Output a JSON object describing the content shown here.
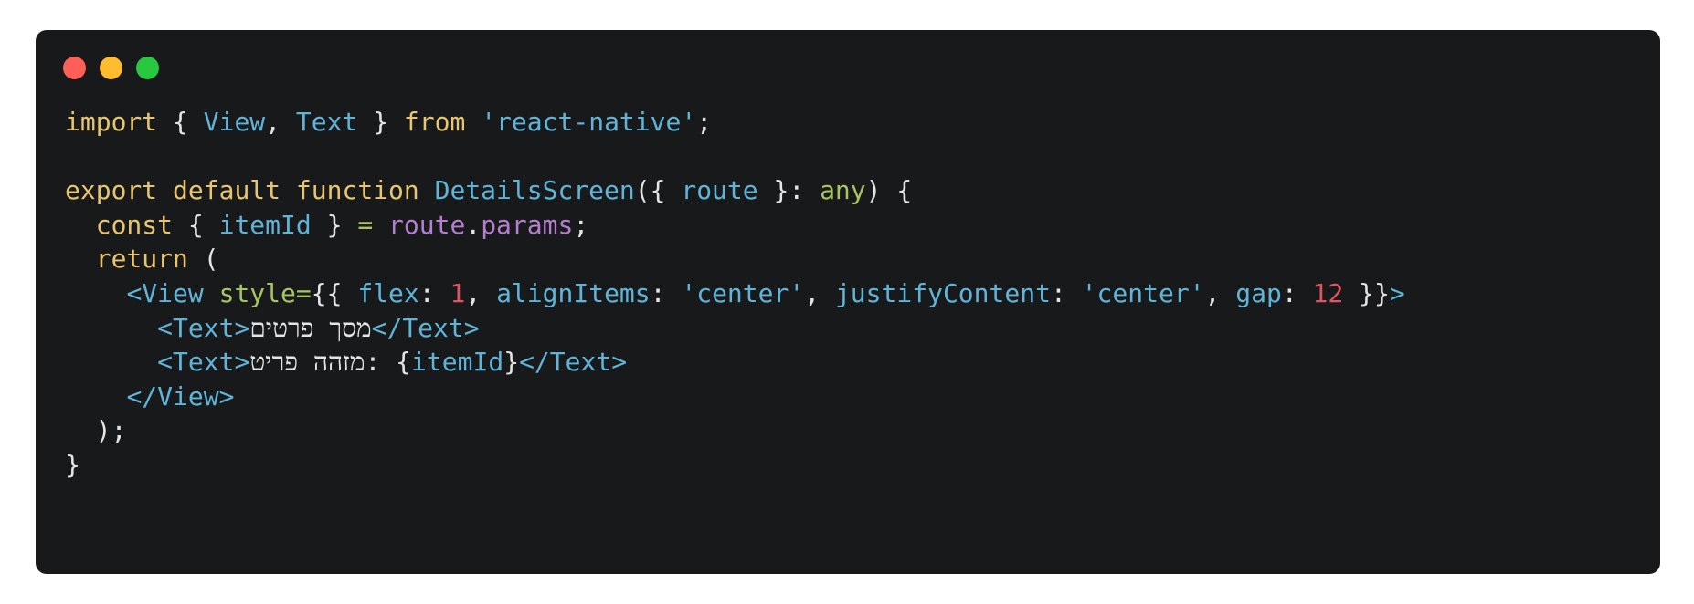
{
  "window": {
    "background": "#18191b",
    "controls": [
      {
        "name": "close",
        "color": "#ff5f57"
      },
      {
        "name": "minimize",
        "color": "#febc2e"
      },
      {
        "name": "zoom",
        "color": "#28c840"
      }
    ]
  },
  "colors": {
    "keyword": "#e8c66f",
    "identifier": "#5fb4d8",
    "string": "#5fb4d8",
    "plain": "#e4e4e4",
    "type": "#a8c55f",
    "property": "#b57fd0",
    "number": "#e05561",
    "operator": "#a8c55f"
  },
  "code": {
    "lines": [
      {
        "tokens": [
          {
            "t": "import",
            "c": "keyword"
          },
          {
            "t": " { ",
            "c": "plain"
          },
          {
            "t": "View",
            "c": "identifier"
          },
          {
            "t": ", ",
            "c": "plain"
          },
          {
            "t": "Text",
            "c": "identifier"
          },
          {
            "t": " } ",
            "c": "plain"
          },
          {
            "t": "from",
            "c": "keyword"
          },
          {
            "t": " ",
            "c": "plain"
          },
          {
            "t": "'react-native'",
            "c": "string"
          },
          {
            "t": ";",
            "c": "plain"
          }
        ]
      },
      {
        "tokens": []
      },
      {
        "tokens": [
          {
            "t": "export",
            "c": "keyword"
          },
          {
            "t": " ",
            "c": "plain"
          },
          {
            "t": "default",
            "c": "keyword"
          },
          {
            "t": " ",
            "c": "plain"
          },
          {
            "t": "function",
            "c": "keyword"
          },
          {
            "t": " ",
            "c": "plain"
          },
          {
            "t": "DetailsScreen",
            "c": "identifier"
          },
          {
            "t": "({ ",
            "c": "plain"
          },
          {
            "t": "route",
            "c": "identifier"
          },
          {
            "t": " }: ",
            "c": "plain"
          },
          {
            "t": "any",
            "c": "type"
          },
          {
            "t": ") {",
            "c": "plain"
          }
        ]
      },
      {
        "tokens": [
          {
            "t": "  ",
            "c": "plain"
          },
          {
            "t": "const",
            "c": "keyword"
          },
          {
            "t": " { ",
            "c": "plain"
          },
          {
            "t": "itemId",
            "c": "identifier"
          },
          {
            "t": " } ",
            "c": "plain"
          },
          {
            "t": "=",
            "c": "operator"
          },
          {
            "t": " ",
            "c": "plain"
          },
          {
            "t": "route",
            "c": "property"
          },
          {
            "t": ".",
            "c": "plain"
          },
          {
            "t": "params",
            "c": "property"
          },
          {
            "t": ";",
            "c": "plain"
          }
        ]
      },
      {
        "tokens": [
          {
            "t": "  ",
            "c": "plain"
          },
          {
            "t": "return",
            "c": "keyword"
          },
          {
            "t": " (",
            "c": "plain"
          }
        ]
      },
      {
        "tokens": [
          {
            "t": "    ",
            "c": "plain"
          },
          {
            "t": "<View",
            "c": "identifier"
          },
          {
            "t": " ",
            "c": "plain"
          },
          {
            "t": "style",
            "c": "type"
          },
          {
            "t": "=",
            "c": "operator"
          },
          {
            "t": "{{ ",
            "c": "plain"
          },
          {
            "t": "flex",
            "c": "identifier"
          },
          {
            "t": ": ",
            "c": "plain"
          },
          {
            "t": "1",
            "c": "number"
          },
          {
            "t": ", ",
            "c": "plain"
          },
          {
            "t": "alignItems",
            "c": "identifier"
          },
          {
            "t": ": ",
            "c": "plain"
          },
          {
            "t": "'center'",
            "c": "string"
          },
          {
            "t": ", ",
            "c": "plain"
          },
          {
            "t": "justifyContent",
            "c": "identifier"
          },
          {
            "t": ": ",
            "c": "plain"
          },
          {
            "t": "'center'",
            "c": "string"
          },
          {
            "t": ", ",
            "c": "plain"
          },
          {
            "t": "gap",
            "c": "identifier"
          },
          {
            "t": ": ",
            "c": "plain"
          },
          {
            "t": "12",
            "c": "number"
          },
          {
            "t": " }}",
            "c": "plain"
          },
          {
            "t": ">",
            "c": "identifier"
          }
        ]
      },
      {
        "tokens": [
          {
            "t": "      ",
            "c": "plain"
          },
          {
            "t": "<Text>",
            "c": "identifier"
          },
          {
            "t": "מסך פרטים",
            "c": "plain",
            "rtl": true
          },
          {
            "t": "</Text>",
            "c": "identifier"
          }
        ]
      },
      {
        "tokens": [
          {
            "t": "      ",
            "c": "plain"
          },
          {
            "t": "<Text>",
            "c": "identifier"
          },
          {
            "t": "מזהה פריט",
            "c": "plain",
            "rtl": true
          },
          {
            "t": ": {",
            "c": "plain"
          },
          {
            "t": "itemId",
            "c": "identifier"
          },
          {
            "t": "}",
            "c": "plain"
          },
          {
            "t": "</Text>",
            "c": "identifier"
          }
        ]
      },
      {
        "tokens": [
          {
            "t": "    ",
            "c": "plain"
          },
          {
            "t": "</View>",
            "c": "identifier"
          }
        ]
      },
      {
        "tokens": [
          {
            "t": "  );",
            "c": "plain"
          }
        ]
      },
      {
        "tokens": [
          {
            "t": "}",
            "c": "plain"
          }
        ]
      }
    ]
  }
}
